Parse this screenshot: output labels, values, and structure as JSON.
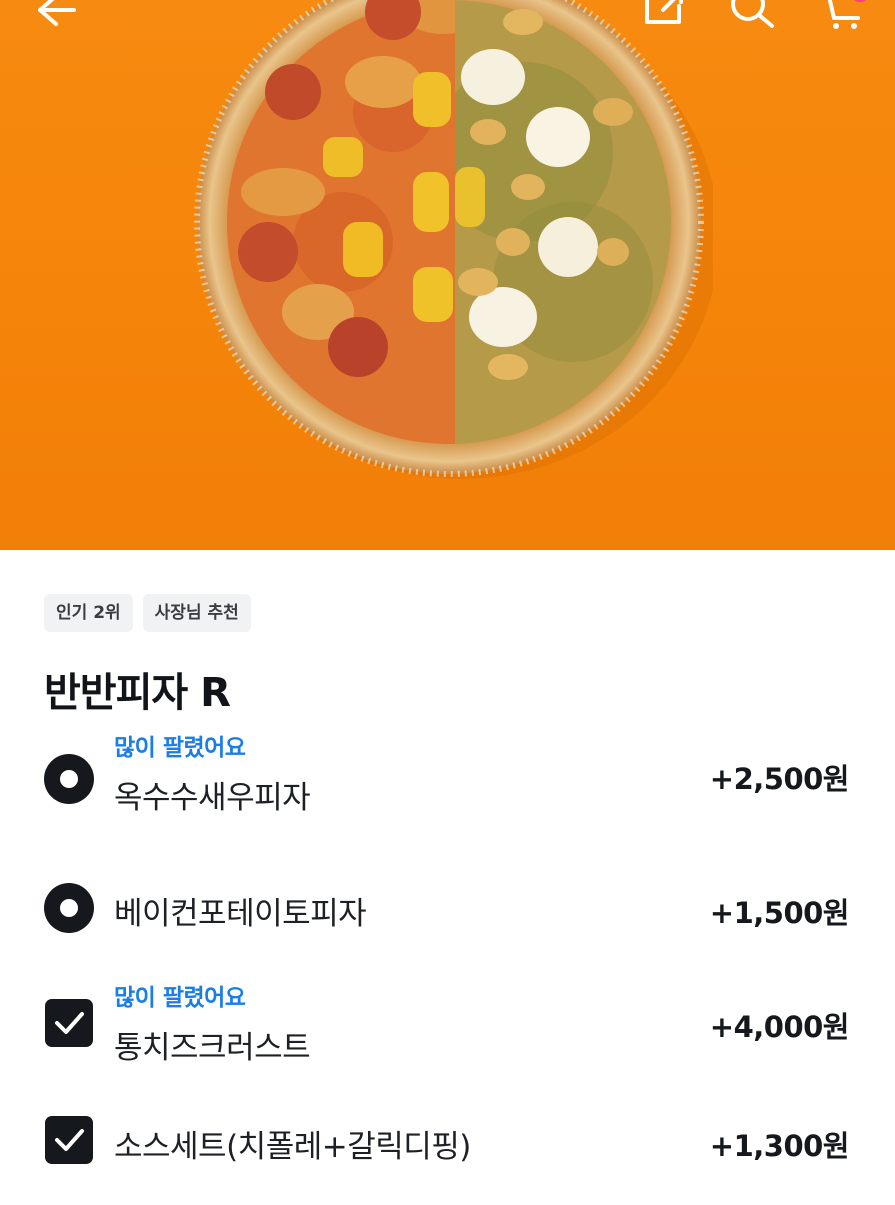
{
  "header": {
    "back_icon": "arrow-left-icon",
    "share_icon": "share-icon",
    "search_icon": "search-icon",
    "cart_icon": "cart-icon"
  },
  "product": {
    "badges": [
      "인기 2위",
      "사장님 추천"
    ],
    "name": "반반피자 R"
  },
  "options": [
    {
      "hot_label": "많이 팔렸어요",
      "name": "옥수수새우피자",
      "price": "+2,500원",
      "control": "radio",
      "selected": true
    },
    {
      "hot_label": "",
      "name": "베이컨포테이토피자",
      "price": "+1,500원",
      "control": "radio",
      "selected": true
    },
    {
      "hot_label": "많이 팔렸어요",
      "name": "통치즈크러스트",
      "price": "+4,000원",
      "control": "checkbox",
      "checked": true
    },
    {
      "hot_label": "",
      "name": "소스세트(치폴레+갈릭디핑)",
      "price": "+1,300원",
      "control": "checkbox",
      "checked": true
    }
  ],
  "colors": {
    "hero_bg": "#f5840a",
    "accent_blue": "#1a7ee6",
    "control_dark": "#15181c",
    "cart_badge": "#ff3d7f"
  }
}
